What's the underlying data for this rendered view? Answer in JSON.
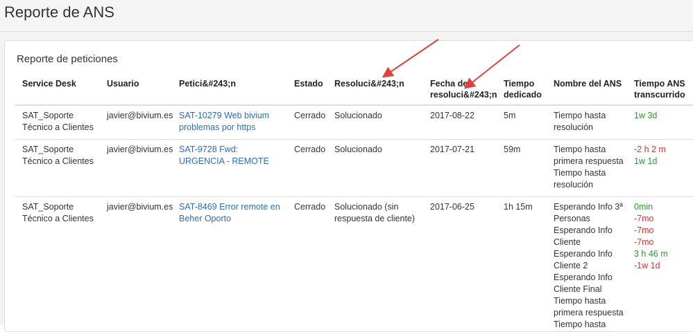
{
  "header": {
    "title": "Reporte de ANS"
  },
  "panel": {
    "title": "Reporte de peticiones"
  },
  "table": {
    "columns": [
      {
        "label": "Service Desk"
      },
      {
        "label": "Usuario"
      },
      {
        "label": "Petici&#243;n"
      },
      {
        "label": "Estado"
      },
      {
        "label": "Resoluci&#243;n"
      },
      {
        "label": "Fecha de resoluci&#243;n"
      },
      {
        "label": "Tiempo dedicado"
      },
      {
        "label": "Nombre del ANS"
      },
      {
        "label": "Tiempo ANS transcurrido"
      }
    ],
    "rows": [
      {
        "service_desk": "SAT_Soporte Técnico a Clientes",
        "usuario": "javier@bivium.es",
        "peticion": "SAT-10279 Web bivium problemas por https",
        "estado": "Cerrado",
        "resolucion": "Solucionado",
        "fecha": "2017-08-22",
        "tiempo": "5m",
        "ans_names": [
          "Tiempo hasta resolución"
        ],
        "ans_times": [
          {
            "text": "1w 3d",
            "status": "green"
          }
        ]
      },
      {
        "service_desk": "SAT_Soporte Técnico a Clientes",
        "usuario": "javier@bivium.es",
        "peticion": "SAT-9728 Fwd: URGENCIA - REMOTE",
        "estado": "Cerrado",
        "resolucion": "Solucionado",
        "fecha": "2017-07-21",
        "tiempo": "59m",
        "ans_names": [
          "Tiempo hasta primera respuesta",
          "Tiempo hasta resolución"
        ],
        "ans_times": [
          {
            "text": "-2 h 2 m",
            "status": "red"
          },
          {
            "text": "1w 1d",
            "status": "green"
          }
        ]
      },
      {
        "service_desk": "SAT_Soporte Técnico a Clientes",
        "usuario": "javier@bivium.es",
        "peticion": "SAT-8469 Error remote en Beher Oporto",
        "estado": "Cerrado",
        "resolucion": "Solucionado (sin respuesta de cliente)",
        "fecha": "2017-06-25",
        "tiempo": "1h 15m",
        "ans_names": [
          "Esperando Info 3ª Personas",
          "Esperando Info Cliente",
          "Esperando Info Cliente 2",
          "Esperando Info Cliente Final",
          "Tiempo hasta primera respuesta",
          "Tiempo hasta"
        ],
        "ans_times": [
          {
            "text": "0min",
            "status": "green"
          },
          {
            "text": "-7mo",
            "status": "red"
          },
          {
            "text": "-7mo",
            "status": "red"
          },
          {
            "text": "-7mo",
            "status": "red"
          },
          {
            "text": "3 h 46 m",
            "status": "green"
          },
          {
            "text": "-1w 1d",
            "status": "red"
          }
        ]
      }
    ]
  },
  "colors": {
    "link": "#2a6ebb",
    "positive": "#2b9a2b",
    "negative": "#e0302a",
    "annotation_arrow": "#e2403a"
  }
}
